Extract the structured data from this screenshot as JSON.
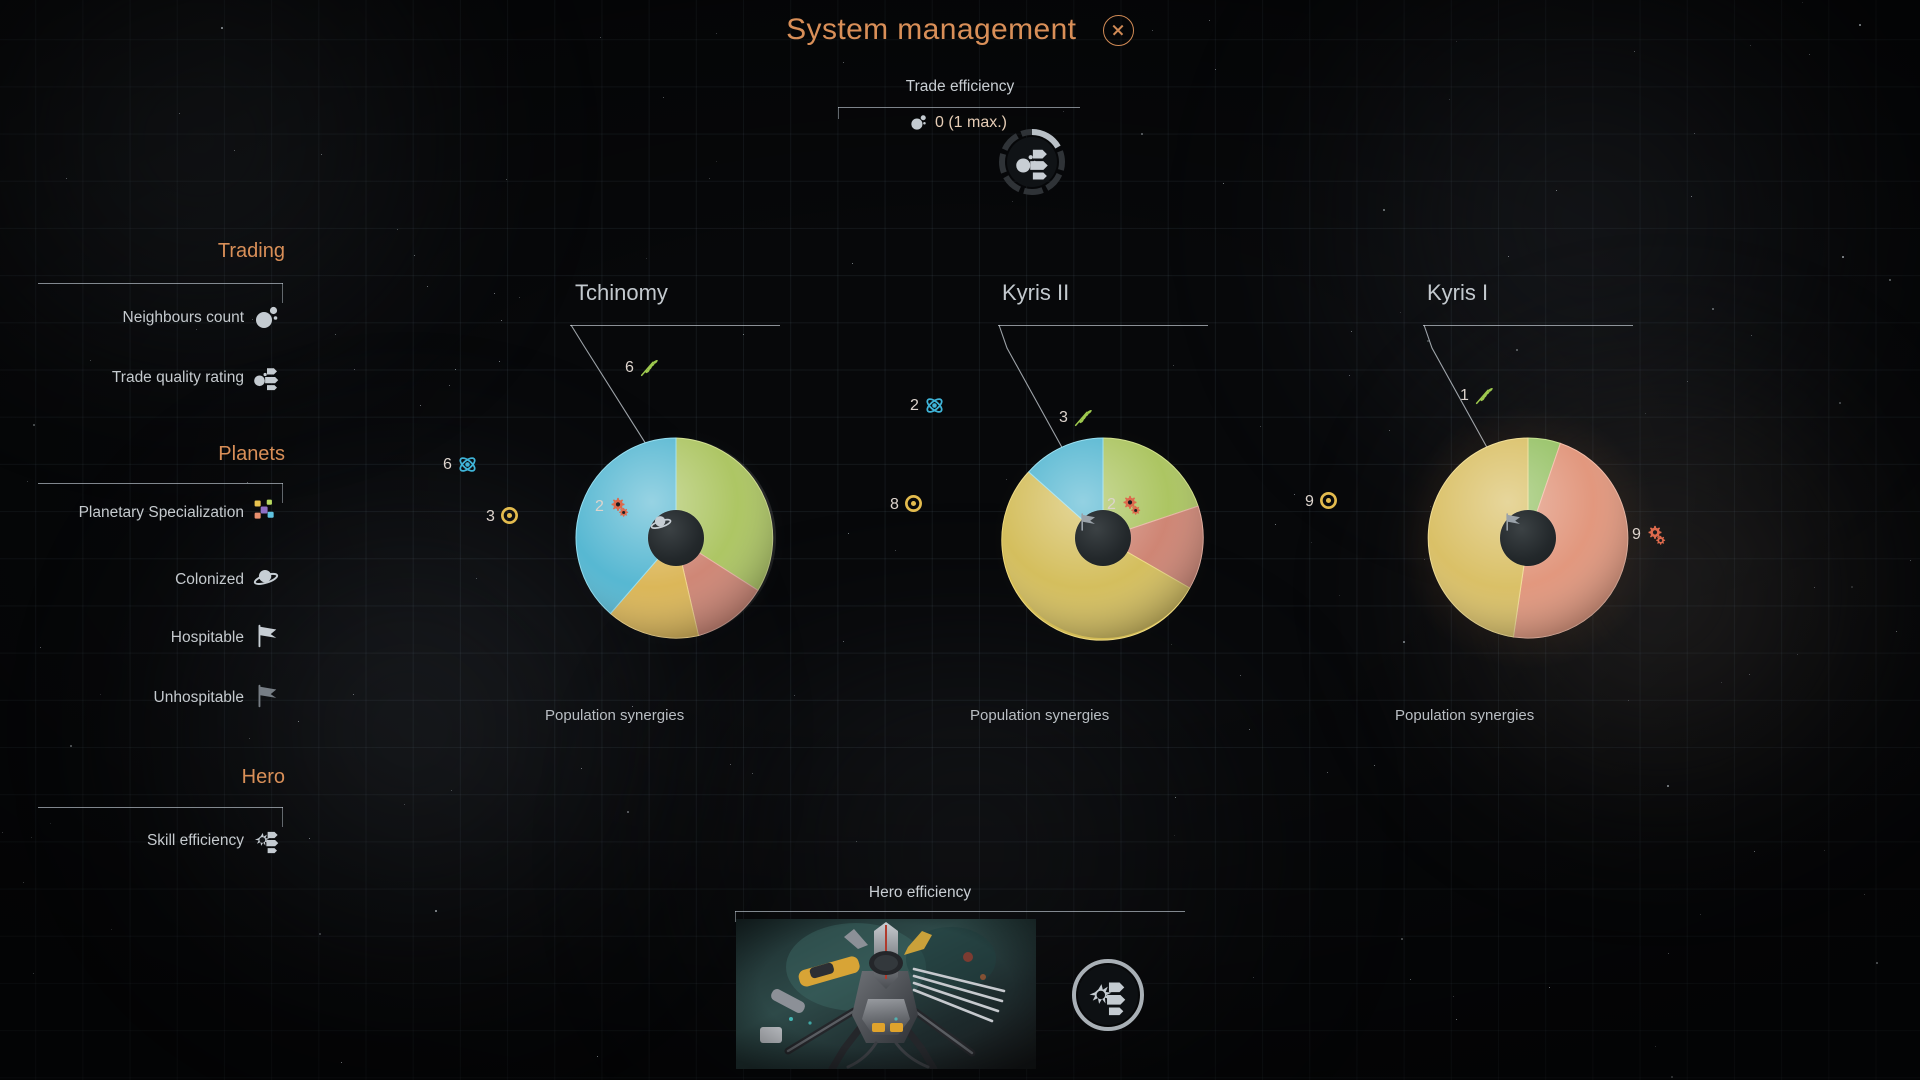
{
  "header": {
    "title": "System management",
    "close_icon": "close-icon"
  },
  "trade_efficiency": {
    "label": "Trade efficiency",
    "value_text": "0 (1 max.)",
    "value": 0,
    "max": 1,
    "icon": "neighbours-count-icon",
    "gauge_icon": "trade-quality-icon",
    "gauge_segments": 8,
    "gauge_filled": 1
  },
  "legend": {
    "sections": [
      {
        "title": "Trading",
        "items": [
          {
            "label": "Neighbours count",
            "icon": "neighbours-count-icon"
          },
          {
            "label": "Trade quality rating",
            "icon": "trade-quality-icon"
          }
        ]
      },
      {
        "title": "Planets",
        "items": [
          {
            "label": "Planetary Specialization",
            "icon": "specialization-icon"
          },
          {
            "label": "Colonized",
            "icon": "colonized-planet-icon"
          },
          {
            "label": "Hospitable",
            "icon": "hospitable-flag-icon"
          },
          {
            "label": "Unhospitable",
            "icon": "unhospitable-flag-icon"
          }
        ]
      },
      {
        "title": "Hero",
        "items": [
          {
            "label": "Skill efficiency",
            "icon": "skill-efficiency-icon"
          }
        ]
      }
    ]
  },
  "planets": [
    {
      "name": "Tchinomy",
      "center_icon": "colonized-planet-icon",
      "synergy_label": "Population synergies",
      "slices": [
        {
          "resource": "food",
          "value": 6,
          "color": "#a8c25a",
          "icon": "wheat-icon",
          "label_value": "6"
        },
        {
          "resource": "industry",
          "value": 2,
          "color": "#cc7f6d",
          "icon": "gears-icon",
          "label_value": "2"
        },
        {
          "resource": "dust",
          "value": 3,
          "color": "#d9b24e",
          "icon": "dust-icon",
          "label_value": "3"
        },
        {
          "resource": "science",
          "value": 6,
          "color": "#4cb3cf",
          "icon": "science-icon",
          "label_value": "6"
        }
      ]
    },
    {
      "name": "Kyris II",
      "center_icon": "hospitable-flag-icon",
      "synergy_label": "Population synergies",
      "slices": [
        {
          "resource": "food",
          "value": 3,
          "color": "#a8c25a",
          "icon": "wheat-icon",
          "label_value": "3"
        },
        {
          "resource": "industry",
          "value": 2,
          "color": "#cc7f6d",
          "icon": "gears-icon",
          "label_value": "2"
        },
        {
          "resource": "dust",
          "value": 8,
          "color": "#d2bb55",
          "icon": "dust-icon",
          "label_value": "8"
        },
        {
          "resource": "science",
          "value": 2,
          "color": "#4cb3cf",
          "icon": "science-icon",
          "label_value": "2"
        }
      ]
    },
    {
      "name": "Kyris I",
      "center_icon": "hospitable-flag-icon",
      "synergy_label": "Population synergies",
      "slices": [
        {
          "resource": "food",
          "value": 1,
          "color": "#93c061",
          "icon": "wheat-icon",
          "label_value": "1"
        },
        {
          "resource": "industry",
          "value": 9,
          "color": "#e09277",
          "icon": "gears-icon",
          "label_value": "9"
        },
        {
          "resource": "dust",
          "value": 9,
          "color": "#d8bd5f",
          "icon": "dust-icon",
          "label_value": "9"
        }
      ]
    }
  ],
  "hero_efficiency": {
    "label": "Hero efficiency",
    "portrait_alt": "hero-portrait",
    "gauge_icon": "skill-efficiency-icon",
    "gauge_segments": 1,
    "gauge_filled": 0
  },
  "colors": {
    "accent": "#d98f58",
    "text": "#c9cdd2",
    "food": "#a8c25a",
    "industry": "#cc7f6d",
    "dust": "#d9b24e",
    "science": "#4cb3cf"
  }
}
